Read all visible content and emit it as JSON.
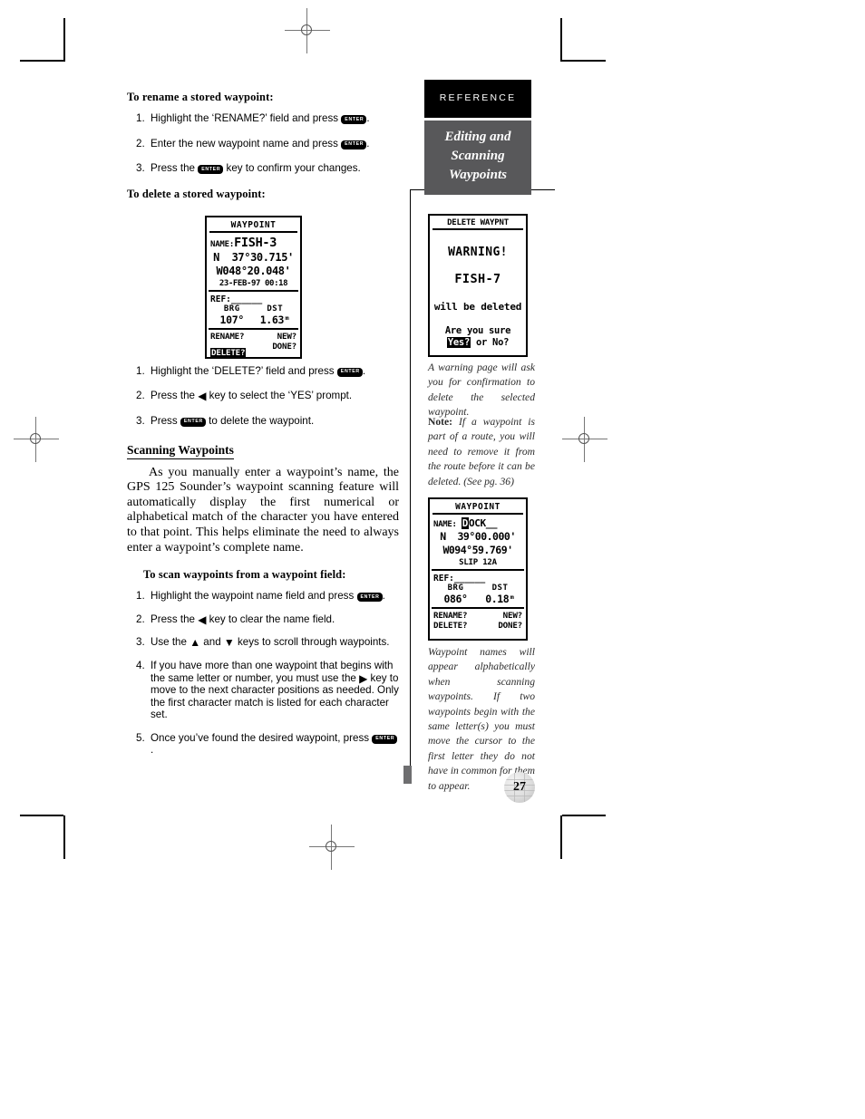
{
  "header": {
    "reference_label": "REFERENCE",
    "chapter_title_lines": [
      "Editing and",
      "Scanning",
      "Waypoints"
    ]
  },
  "main": {
    "rename_heading": "To rename a stored waypoint:",
    "rename_steps": [
      {
        "num": "1.",
        "before": "Highlight the ‘RENAME?’ field and press ",
        "key": "ENTER",
        "after": "."
      },
      {
        "num": "2.",
        "before": "Enter the new waypoint name and press ",
        "key": "ENTER",
        "after": "."
      },
      {
        "num": "3.",
        "before": "Press the ",
        "key": "ENTER",
        "after": " key to confirm your changes."
      }
    ],
    "delete_heading": "To delete a stored waypoint:",
    "delete_steps": [
      {
        "num": "1.",
        "before": "Highlight the ‘DELETE?’ field and press ",
        "key": "ENTER",
        "after": "."
      },
      {
        "num": "2.",
        "before": "Press the ",
        "arrow": "◀",
        "after": " key to select the ‘YES’ prompt."
      },
      {
        "num": "3.",
        "before": "Press ",
        "key": "ENTER",
        "after": " to delete the waypoint."
      }
    ],
    "section_heading": "Scanning Waypoints",
    "section_body": "As you manually enter a waypoint’s name, the GPS 125 Sounder’s waypoint scanning feature will automatically display the first numerical or alphabetical match of the character you have entered to that point. This helps eliminate the need to always enter a waypoint’s complete name.",
    "scan_heading": "To scan waypoints from a waypoint field:",
    "scan_steps": [
      {
        "num": "1.",
        "before": "Highlight the waypoint name field and press ",
        "key": "ENTER",
        "after": "."
      },
      {
        "num": "2.",
        "before": "Press the ",
        "arrow": "◀",
        "after": " key to clear the name field."
      },
      {
        "num": "3.",
        "before": "Use the ",
        "arrow": "▲",
        "mid": " and ",
        "arrow2": "▼",
        "after": " keys to scroll through waypoints."
      },
      {
        "num": "4.",
        "before": "If you have more than one waypoint that begins with the same letter or number, you must use the ",
        "arrow": "▶",
        "after": " key to move to the next character positions as needed. Only the first character match is listed for each character set."
      },
      {
        "num": "5.",
        "before": "Once you’ve found the desired waypoint, press ",
        "key": "ENTER",
        "after": "."
      }
    ]
  },
  "screens": {
    "waypoint_fish3": {
      "title": "WAYPOINT",
      "name_label": "NAME:",
      "name_value": "FISH-3",
      "lat": "N  37°30.715'",
      "lon": "W048°20.048'",
      "datetime": "23-FEB-97 00:18",
      "ref_label": "REF:",
      "ref_value": "______",
      "brg_label": "BRG",
      "dst_label": "DST",
      "brg_value": "107°",
      "dst_value": "1.63ᵐ",
      "opt_rename": "RENAME?",
      "opt_new": "NEW?",
      "opt_delete": "DELETE?",
      "opt_done": "DONE?",
      "highlighted_option": "DELETE?"
    },
    "delete_warning": {
      "title": "DELETE WAYPNT",
      "warning": "WARNING!",
      "waypoint_name": "FISH-7",
      "line3": "will be deleted",
      "line4": "Are you sure",
      "yes": "Yes?",
      "line5": " or No?",
      "highlighted_option": "Yes?"
    },
    "waypoint_dock": {
      "title": "WAYPOINT",
      "name_label": "NAME:",
      "name_first_char": "D",
      "name_rest": "OCK__",
      "lat": "N  39°00.000'",
      "lon": "W094°59.769'",
      "comment": "SLIP 12A",
      "ref_label": "REF:",
      "ref_value": "______",
      "brg_label": "BRG",
      "dst_label": "DST",
      "brg_value": "086°",
      "dst_value": "0.18ᵐ",
      "opt_rename": "RENAME?",
      "opt_new": "NEW?",
      "opt_delete": "DELETE?",
      "opt_done": "DONE?"
    }
  },
  "captions": {
    "caption1": "A warning page will ask you for confirmation to delete the selected waypoint.",
    "note_label": "Note:",
    "note_text": " If a waypoint is part of a route, you will need to remove it from the route before it can be deleted. (See pg. 36)",
    "caption3": "Waypoint names will appear alphabetically when scanning waypoints. If two waypoints begin with the same letter(s) you must move the cursor to the first letter they do not have in common for them to appear."
  },
  "footer": {
    "page_number": "27"
  },
  "colors": {
    "header_black": "#000000",
    "chapter_gray": "#58585a",
    "marker_gray": "#6e6e70"
  }
}
